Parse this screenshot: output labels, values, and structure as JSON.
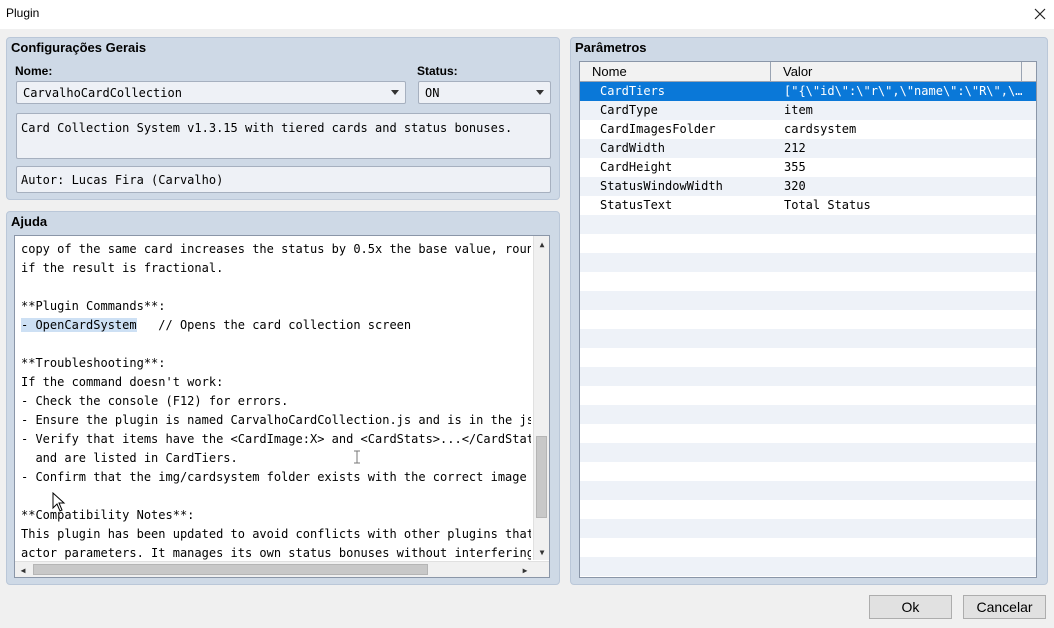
{
  "window": {
    "title": "Plugin"
  },
  "general": {
    "title": "Configurações Gerais",
    "name_label": "Nome:",
    "name_value": "CarvalhoCardCollection",
    "status_label": "Status:",
    "status_value": "ON",
    "description": "Card Collection System v1.3.15 with tiered cards and status bonuses.",
    "author": "Autor: Lucas Fira (Carvalho)"
  },
  "help": {
    "title": "Ajuda",
    "lines": [
      "copy of the same card increases the status by 0.5x the base value, rounded up",
      "if the result is fractional.",
      "",
      "**Plugin Commands**:",
      "- OpenCardSystem",
      "",
      "**Troubleshooting**:",
      "If the command doesn't work:",
      "- Check the console (F12) for errors.",
      "- Ensure the plugin is named CarvalhoCardCollection.js and is in the js/plugin",
      "- Verify that items have the <CardImage:X> and <CardStats>...</CardStats> tags",
      "  and are listed in CardTiers.",
      "- Confirm that the img/cardsystem folder exists with the correct image files.",
      "",
      "**Compatibility Notes**:",
      "This plugin has been updated to avoid conflicts with other plugins that modify",
      "actor parameters. It manages its own status bonuses without interfering with"
    ],
    "command_comment": "   // Opens the card collection screen"
  },
  "params": {
    "title": "Parâmetros",
    "col_name": "Nome",
    "col_value": "Valor",
    "rows": [
      {
        "name": "CardTiers",
        "value": "[\"{\\\"id\\\":\\\"r\\\",\\\"name\\\":\\\"R\\\",\\\"c…",
        "selected": true
      },
      {
        "name": "CardType",
        "value": "item"
      },
      {
        "name": "CardImagesFolder",
        "value": "cardsystem"
      },
      {
        "name": "CardWidth",
        "value": "212"
      },
      {
        "name": "CardHeight",
        "value": "355"
      },
      {
        "name": "StatusWindowWidth",
        "value": "320"
      },
      {
        "name": "StatusText",
        "value": "Total Status"
      }
    ]
  },
  "buttons": {
    "ok": "Ok",
    "cancel": "Cancelar"
  }
}
